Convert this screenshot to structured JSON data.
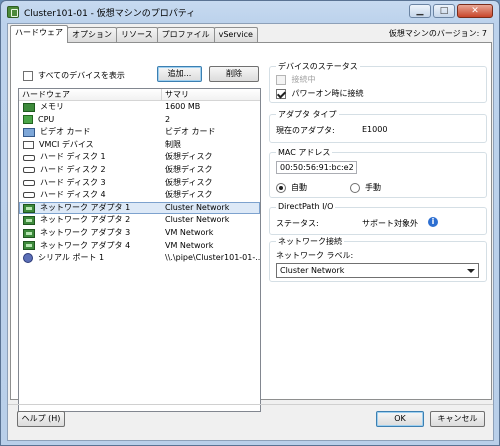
{
  "window": {
    "title": "Cluster101-01 - 仮想マシンのプロパティ",
    "minimize": "▁",
    "maximize": "□",
    "close": "✕"
  },
  "version": "仮想マシンのバージョン: 7",
  "tabs": [
    {
      "label": "ハードウェア",
      "active": true
    },
    {
      "label": "オプション"
    },
    {
      "label": "リソース"
    },
    {
      "label": "プロファイル"
    },
    {
      "label": "vService"
    }
  ],
  "hardware": {
    "show_all_label": "すべてのデバイスを表示",
    "add_button": "追加...",
    "remove_button": "削除",
    "columns": [
      "ハードウェア",
      "サマリ"
    ],
    "rows": [
      {
        "icon": "memory-icon",
        "name": "メモリ",
        "summary": "1600 MB"
      },
      {
        "icon": "cpu-icon",
        "name": "CPU",
        "summary": "2"
      },
      {
        "icon": "video-card-icon",
        "name": "ビデオ カード",
        "summary": "ビデオ カード"
      },
      {
        "icon": "vmci-device-icon",
        "name": "VMCI デバイス",
        "summary": "制限"
      },
      {
        "icon": "hard-disk-icon",
        "name": "ハード ディスク 1",
        "summary": "仮想ディスク"
      },
      {
        "icon": "hard-disk-icon",
        "name": "ハード ディスク 2",
        "summary": "仮想ディスク"
      },
      {
        "icon": "hard-disk-icon",
        "name": "ハード ディスク 3",
        "summary": "仮想ディスク"
      },
      {
        "icon": "hard-disk-icon",
        "name": "ハード ディスク 4",
        "summary": "仮想ディスク"
      },
      {
        "icon": "network-adapter-icon",
        "name": "ネットワーク アダプタ 1",
        "summary": "Cluster Network",
        "selected": true
      },
      {
        "icon": "network-adapter-icon",
        "name": "ネットワーク アダプタ 2",
        "summary": "Cluster Network"
      },
      {
        "icon": "network-adapter-icon",
        "name": "ネットワーク アダプタ 3",
        "summary": "VM Network"
      },
      {
        "icon": "network-adapter-icon",
        "name": "ネットワーク アダプタ 4",
        "summary": "VM Network"
      },
      {
        "icon": "serial-port-icon",
        "name": "シリアル ポート 1",
        "summary": "\\\\.\\pipe\\Cluster101-01-..."
      }
    ]
  },
  "device_status": {
    "title": "デバイスのステータス",
    "connected_label": "接続中",
    "connected_checked": false,
    "connect_at_power_on_label": "パワーオン時に接続",
    "connect_at_power_on_checked": true
  },
  "adapter_type": {
    "title": "アダプタ タイプ",
    "current_label": "現在のアダプタ:",
    "current_value": "E1000"
  },
  "mac_address": {
    "title": "MAC アドレス",
    "value": "00:50:56:91:bc:e2",
    "auto_label": "自動",
    "manual_label": "手動",
    "selected": "自動"
  },
  "directpath": {
    "title": "DirectPath I/O",
    "status_label": "ステータス:",
    "status_value": "サポート対象外"
  },
  "network_connection": {
    "title": "ネットワーク接続",
    "label": "ネットワーク ラベル:",
    "selected": "Cluster Network"
  },
  "footer": {
    "help": "ヘルプ (H)",
    "ok": "OK",
    "cancel": "キャンセル"
  }
}
